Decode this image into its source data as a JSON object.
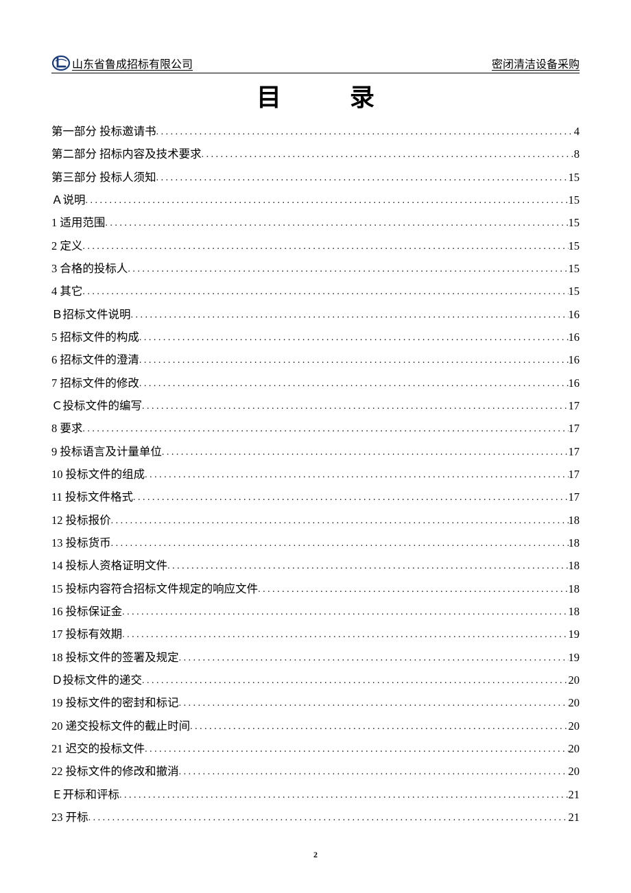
{
  "header": {
    "company": "山东省鲁成招标有限公司",
    "docName": "密闭清洁设备采购"
  },
  "title": "目录",
  "toc": [
    {
      "label": "第一部分 投标邀请书",
      "page": "4"
    },
    {
      "label": "第二部分 招标内容及技术要求",
      "page": "8"
    },
    {
      "label": "第三部分 投标人须知",
      "page": "15"
    },
    {
      "label": "Ａ说明",
      "page": "15"
    },
    {
      "label": "1 适用范围",
      "page": "15"
    },
    {
      "label": "2 定义",
      "page": "15"
    },
    {
      "label": "3 合格的投标人",
      "page": "15"
    },
    {
      "label": "4 其它",
      "page": "15"
    },
    {
      "label": "Ｂ招标文件说明",
      "page": "16"
    },
    {
      "label": "5 招标文件的构成",
      "page": "16"
    },
    {
      "label": "6 招标文件的澄清",
      "page": "16"
    },
    {
      "label": "7 招标文件的修改",
      "page": "16"
    },
    {
      "label": "Ｃ投标文件的编写",
      "page": "17"
    },
    {
      "label": "8 要求",
      "page": "17"
    },
    {
      "label": "9 投标语言及计量单位",
      "page": "17"
    },
    {
      "label": "10 投标文件的组成",
      "page": "17"
    },
    {
      "label": "11 投标文件格式",
      "page": "17"
    },
    {
      "label": "12 投标报价",
      "page": "18"
    },
    {
      "label": "13 投标货币",
      "page": "18"
    },
    {
      "label": "14 投标人资格证明文件",
      "page": "18"
    },
    {
      "label": "15 投标内容符合招标文件规定的响应文件",
      "page": "18"
    },
    {
      "label": "16 投标保证金",
      "page": "18"
    },
    {
      "label": "17 投标有效期",
      "page": "19"
    },
    {
      "label": "18 投标文件的签署及规定",
      "page": "19"
    },
    {
      "label": "Ｄ投标文件的递交",
      "page": "20"
    },
    {
      "label": "19 投标文件的密封和标记",
      "page": "20"
    },
    {
      "label": "20 递交投标文件的截止时间",
      "page": "20"
    },
    {
      "label": "21 迟交的投标文件",
      "page": "20"
    },
    {
      "label": "22 投标文件的修改和撤消",
      "page": "20"
    },
    {
      "label": "Ｅ开标和评标",
      "page": "21"
    },
    {
      "label": "23 开标",
      "page": "21"
    }
  ],
  "pageNumber": "2"
}
